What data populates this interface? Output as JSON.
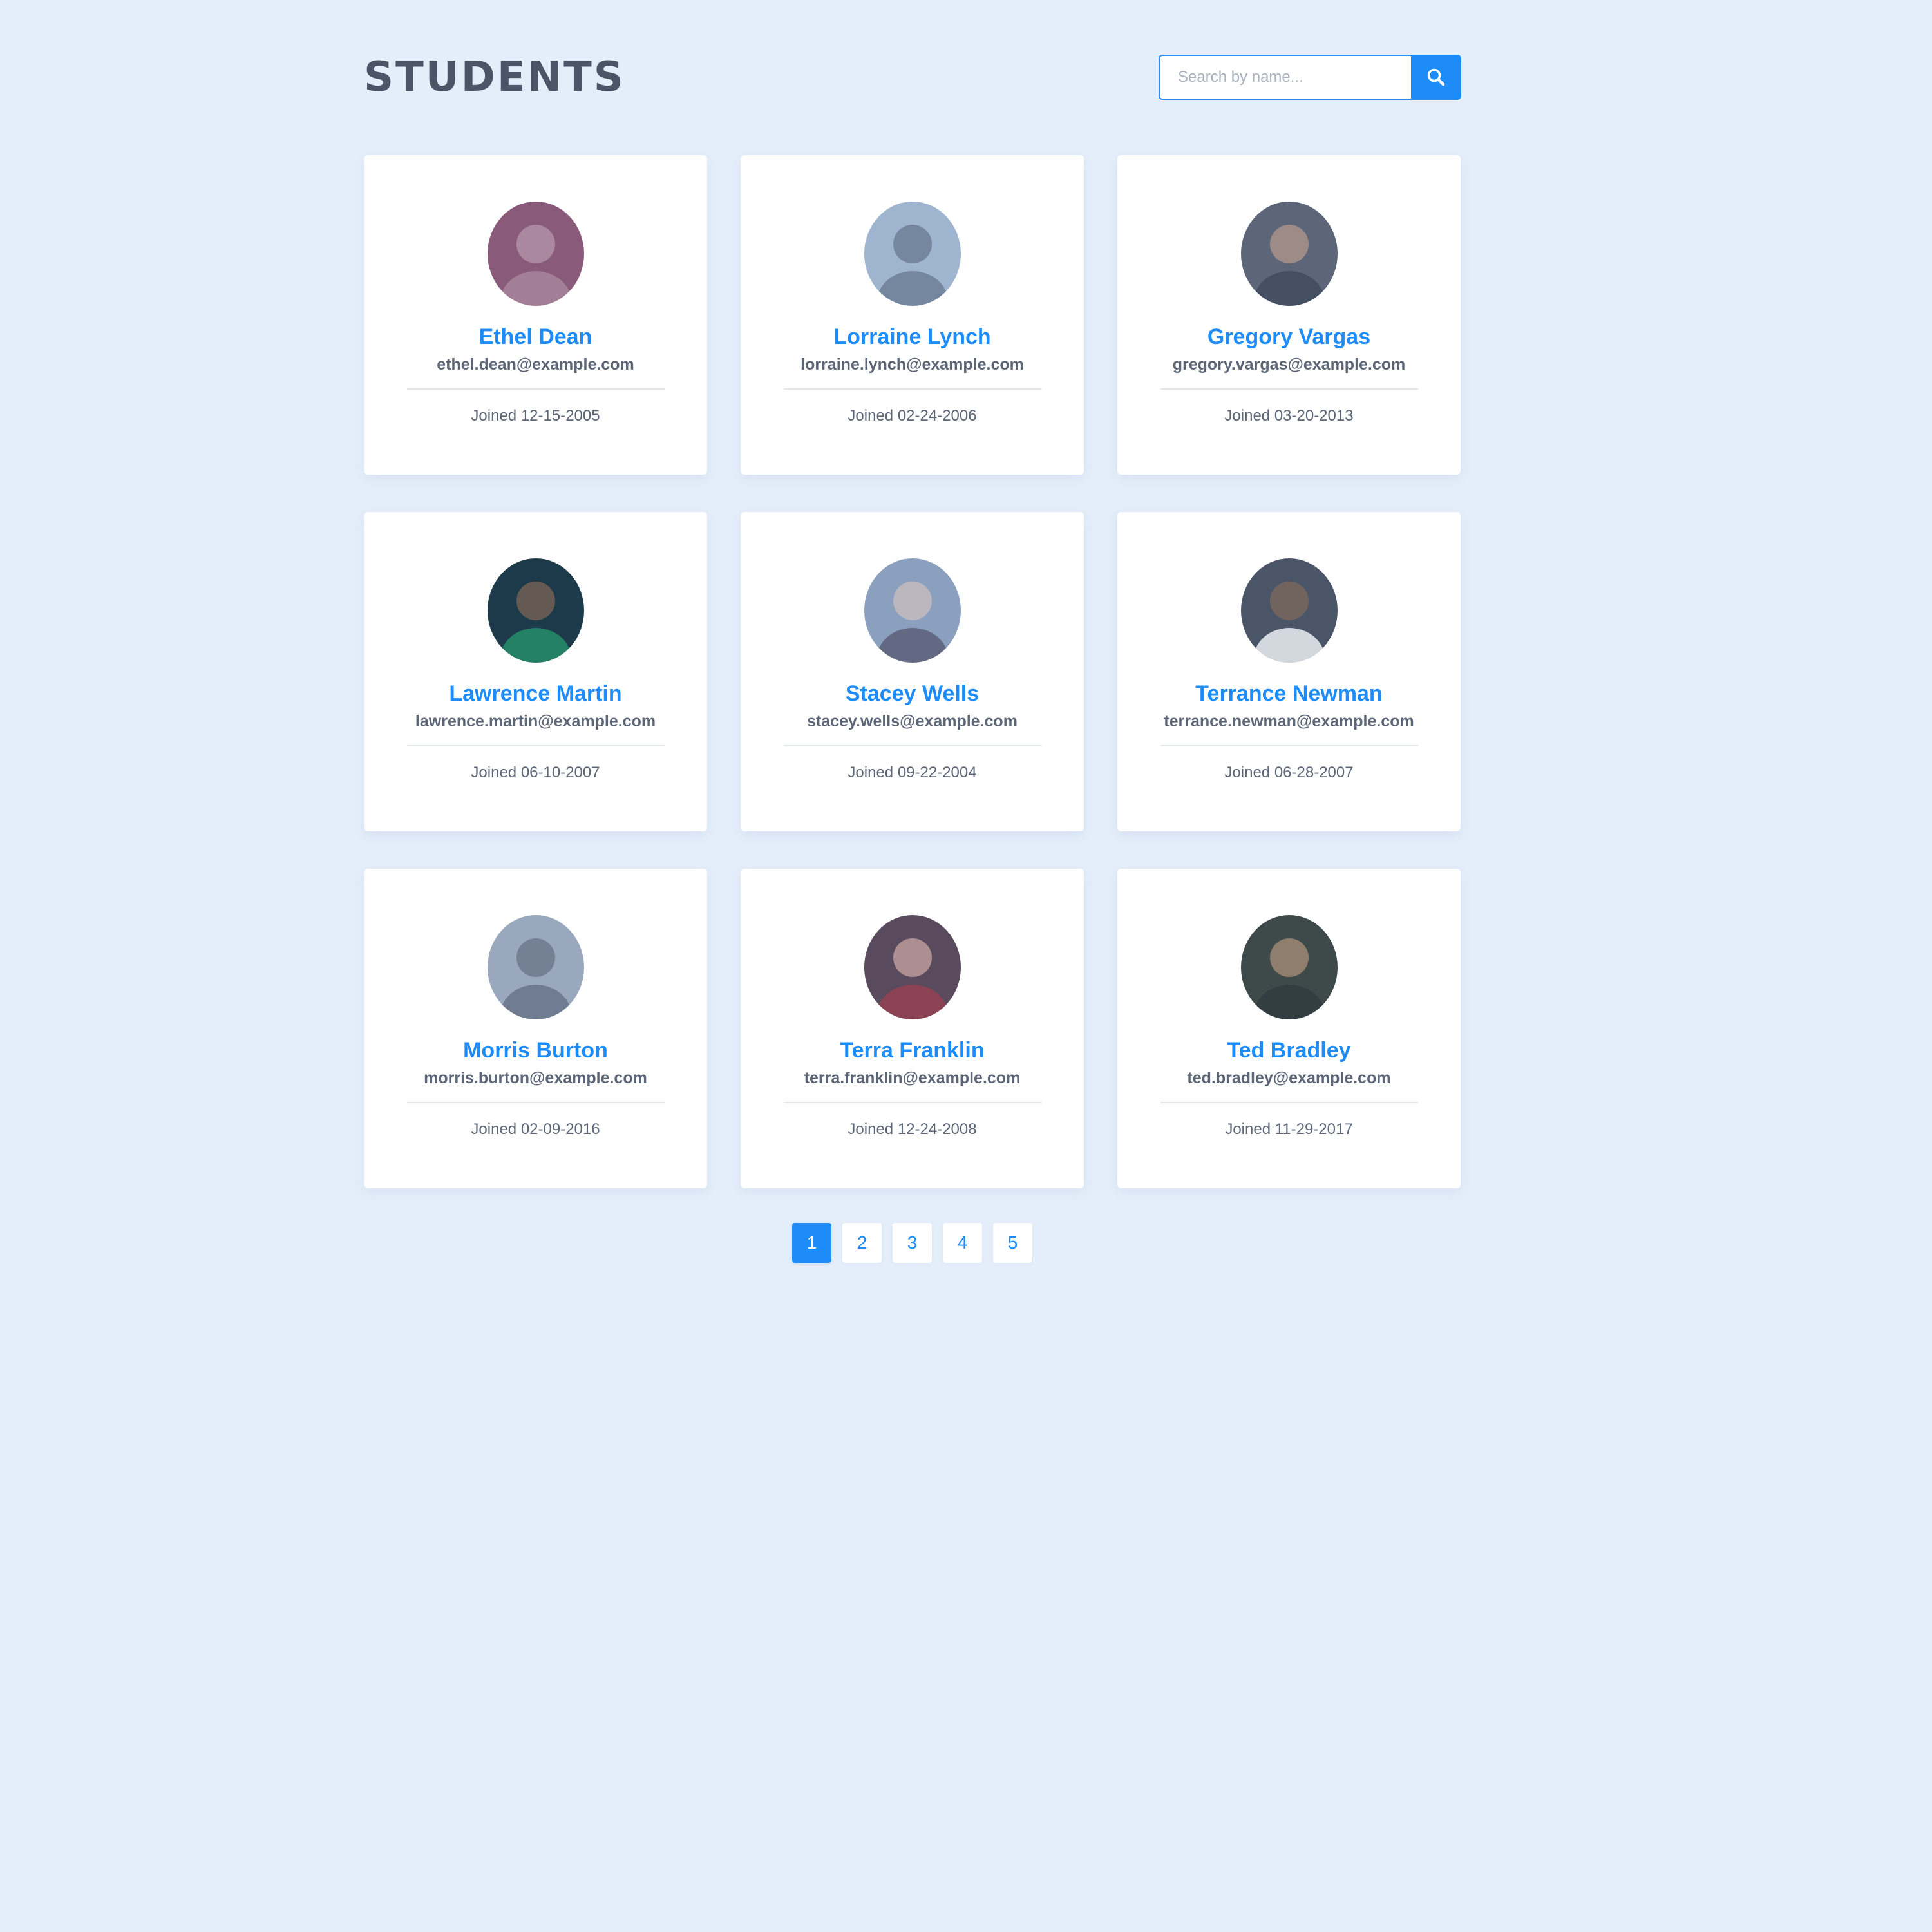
{
  "header": {
    "title": "STUDENTS"
  },
  "search": {
    "placeholder": "Search by name...",
    "icon": "search-icon"
  },
  "students": [
    {
      "name": "Ethel Dean",
      "email": "ethel.dean@example.com",
      "joined": "Joined 12-15-2005",
      "avatar_color": "#8a5a7a"
    },
    {
      "name": "Lorraine Lynch",
      "email": "lorraine.lynch@example.com",
      "joined": "Joined 02-24-2006",
      "avatar_color": "#9fb4cf"
    },
    {
      "name": "Gregory Vargas",
      "email": "gregory.vargas@example.com",
      "joined": "Joined 03-20-2013",
      "avatar_color": "#5d6678"
    },
    {
      "name": "Lawrence Martin",
      "email": "lawrence.martin@example.com",
      "joined": "Joined 06-10-2007",
      "avatar_color": "#1d3a4a"
    },
    {
      "name": "Stacey Wells",
      "email": "stacey.wells@example.com",
      "joined": "Joined 09-22-2004",
      "avatar_color": "#8aa0be"
    },
    {
      "name": "Terrance Newman",
      "email": "terrance.newman@example.com",
      "joined": "Joined 06-28-2007",
      "avatar_color": "#4a5568"
    },
    {
      "name": "Morris Burton",
      "email": "morris.burton@example.com",
      "joined": "Joined 02-09-2016",
      "avatar_color": "#9aa8bd"
    },
    {
      "name": "Terra Franklin",
      "email": "terra.franklin@example.com",
      "joined": "Joined 12-24-2008",
      "avatar_color": "#5a4a5e"
    },
    {
      "name": "Ted Bradley",
      "email": "ted.bradley@example.com",
      "joined": "Joined 11-29-2017",
      "avatar_color": "#3e4a4a"
    }
  ],
  "pagination": {
    "pages": [
      "1",
      "2",
      "3",
      "4",
      "5"
    ],
    "current": "1"
  },
  "colors": {
    "accent": "#1e8cf8",
    "background": "#e4eefa",
    "title": "#4a5568",
    "muted_text": "#5c6677"
  }
}
